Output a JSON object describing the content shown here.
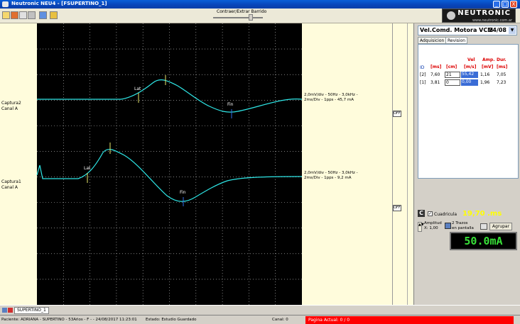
{
  "window": {
    "title": "Neutronic NEU4 - [FSUPERTINO_1]",
    "controls": [
      "_",
      "□",
      "X"
    ]
  },
  "toolbar": {
    "contrast_label": "Contraer/Extrar Barrido"
  },
  "logo": {
    "brand": "NEUTRONIC",
    "url": "www.neutronic.com.ar"
  },
  "traces": [
    {
      "side_name": "Captura2",
      "side_channel": "Canal A",
      "info1": "2,0mV/div - 50Hz - 3,0kHz -",
      "info2": "2ms/Div - 1pps - 45,7 mA",
      "lat": "Lat",
      "fin": "Fin"
    },
    {
      "side_name": "Captura1",
      "side_channel": "Canal A",
      "info1": "2,0mV/div - 50Hz - 3,0kHz -",
      "info2": "2ms/Div - 1pps - 9,2 mA",
      "lat": "Lat",
      "fin": "Fin"
    }
  ],
  "scroll_tags": [
    "OFF",
    "OFF"
  ],
  "panel": {
    "selector": {
      "label": "Vel.Comd. Motora VCM",
      "value": "24/08"
    },
    "tabs": [
      "Adquisicion",
      "Revision"
    ],
    "headers": {
      "row1": [
        "Vel",
        "Amp.",
        "Dur."
      ],
      "row2": [
        "ID",
        "[ms]",
        "[cm]",
        "[m/s]",
        "[mV]",
        "[ms]"
      ]
    },
    "rows": [
      {
        "id": "[2]",
        "ms": "7,60",
        "cm": "21",
        "vel": "55,42",
        "amp": "1,16",
        "dur": "7,05"
      },
      {
        "id": "[1]",
        "ms": "3,81",
        "cm": "0",
        "vel": "0,00",
        "amp": "1,96",
        "dur": "7,23"
      }
    ],
    "cuadricula_label": "Cuadricula",
    "speed": "19,70 .ms",
    "amplitud_label": "Amplitud",
    "amplitud_value": "X: 1,00",
    "trazos_label1": "2 Trazos",
    "trazos_label2": "en pantalla",
    "agrupar": "Agrupar",
    "digital": "50.0mA"
  },
  "tabstrip": {
    "tab": "SUPERTINO_1"
  },
  "status": {
    "patient": "Paciente: ADRIANA - SUPERTINO - 53Años - F - - 24/08/2017 11:23:01",
    "estado": "Estado: Estudio Guardado",
    "canal": "Canal: 0",
    "pagina": "Pagina Actual: 0 / 0"
  },
  "colors": {
    "trace": "#2ee6e6",
    "marker_lat": "#e8e86a",
    "marker_fin": "#2f6ee8",
    "grid": "#cfcfcf",
    "status_red": "#ff0000"
  }
}
